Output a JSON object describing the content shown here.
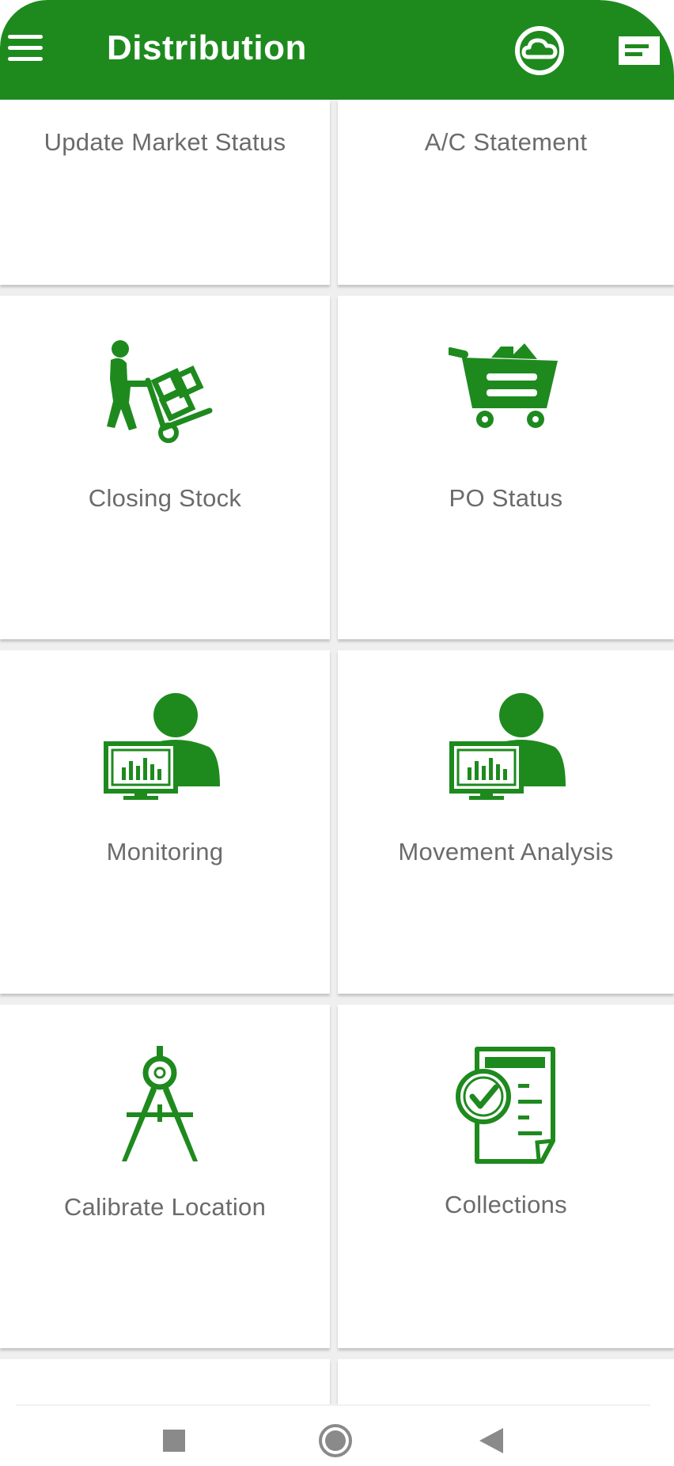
{
  "app": {
    "title": "Distribution",
    "accent_color": "#1e8a1e",
    "icons": {
      "menu": "hamburger-menu-icon",
      "sync": "cloud-sync-icon",
      "messages": "message-icon"
    }
  },
  "tiles": [
    {
      "label": "Update Market Status",
      "icon": "none"
    },
    {
      "label": "A/C Statement",
      "icon": "none"
    },
    {
      "label": "Closing Stock",
      "icon": "delivery-trolley-icon"
    },
    {
      "label": "PO Status",
      "icon": "shopping-cart-icon"
    },
    {
      "label": "Monitoring",
      "icon": "monitoring-user-icon"
    },
    {
      "label": "Movement Analysis",
      "icon": "analysis-user-icon"
    },
    {
      "label": "Calibrate Location",
      "icon": "compass-icon"
    },
    {
      "label": "Collections",
      "icon": "checklist-document-icon"
    }
  ],
  "navigation": {
    "buttons": [
      "recent-apps",
      "home",
      "back"
    ]
  }
}
